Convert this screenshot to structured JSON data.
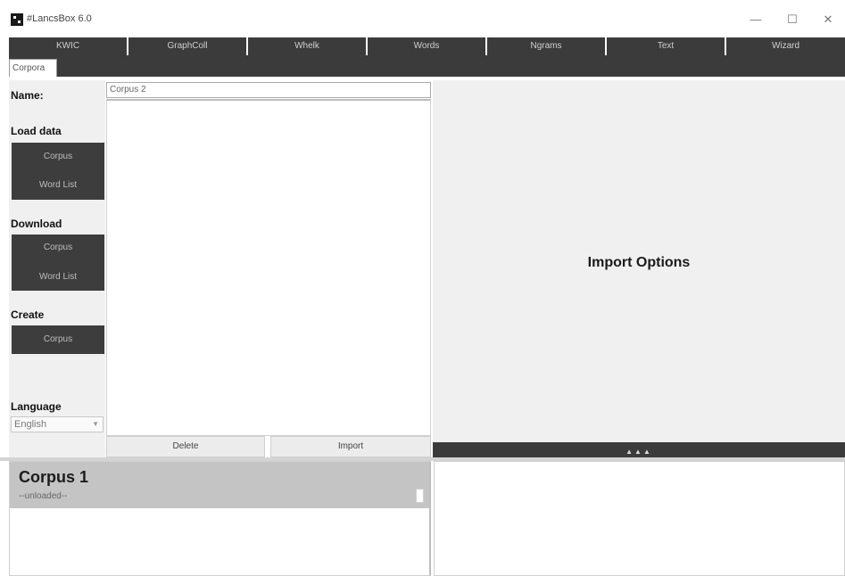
{
  "window": {
    "title": "#LancsBox 6.0",
    "controls": {
      "minimize": "—",
      "maximize": "☐",
      "close": "✕"
    }
  },
  "main_tabs": [
    {
      "label": "KWIC"
    },
    {
      "label": "GraphColl"
    },
    {
      "label": "Whelk"
    },
    {
      "label": "Words"
    },
    {
      "label": "Ngrams"
    },
    {
      "label": "Text"
    },
    {
      "label": "Wizard"
    }
  ],
  "sub_tabs": {
    "active": "Corpora"
  },
  "left_panel": {
    "name_label": "Name:",
    "load_data": {
      "label": "Load data",
      "buttons": [
        "Corpus",
        "Word List"
      ]
    },
    "download": {
      "label": "Download",
      "buttons": [
        "Corpus",
        "Word List"
      ]
    },
    "create": {
      "label": "Create",
      "buttons": [
        "Corpus"
      ]
    },
    "language": {
      "label": "Language",
      "selected": "English"
    }
  },
  "name_input": {
    "value": "Corpus 2"
  },
  "actions": {
    "delete": "Delete",
    "import": "Import"
  },
  "import_options": {
    "title": "Import Options",
    "collapse_arrows": "▲▲▲"
  },
  "corpus_card": {
    "title": "Corpus 1",
    "status": "--unloaded--"
  },
  "colors": {
    "dark_bar": "#3b3b3b",
    "panel_bg": "#f0f0f0",
    "card_bg": "#c4c4c4"
  }
}
